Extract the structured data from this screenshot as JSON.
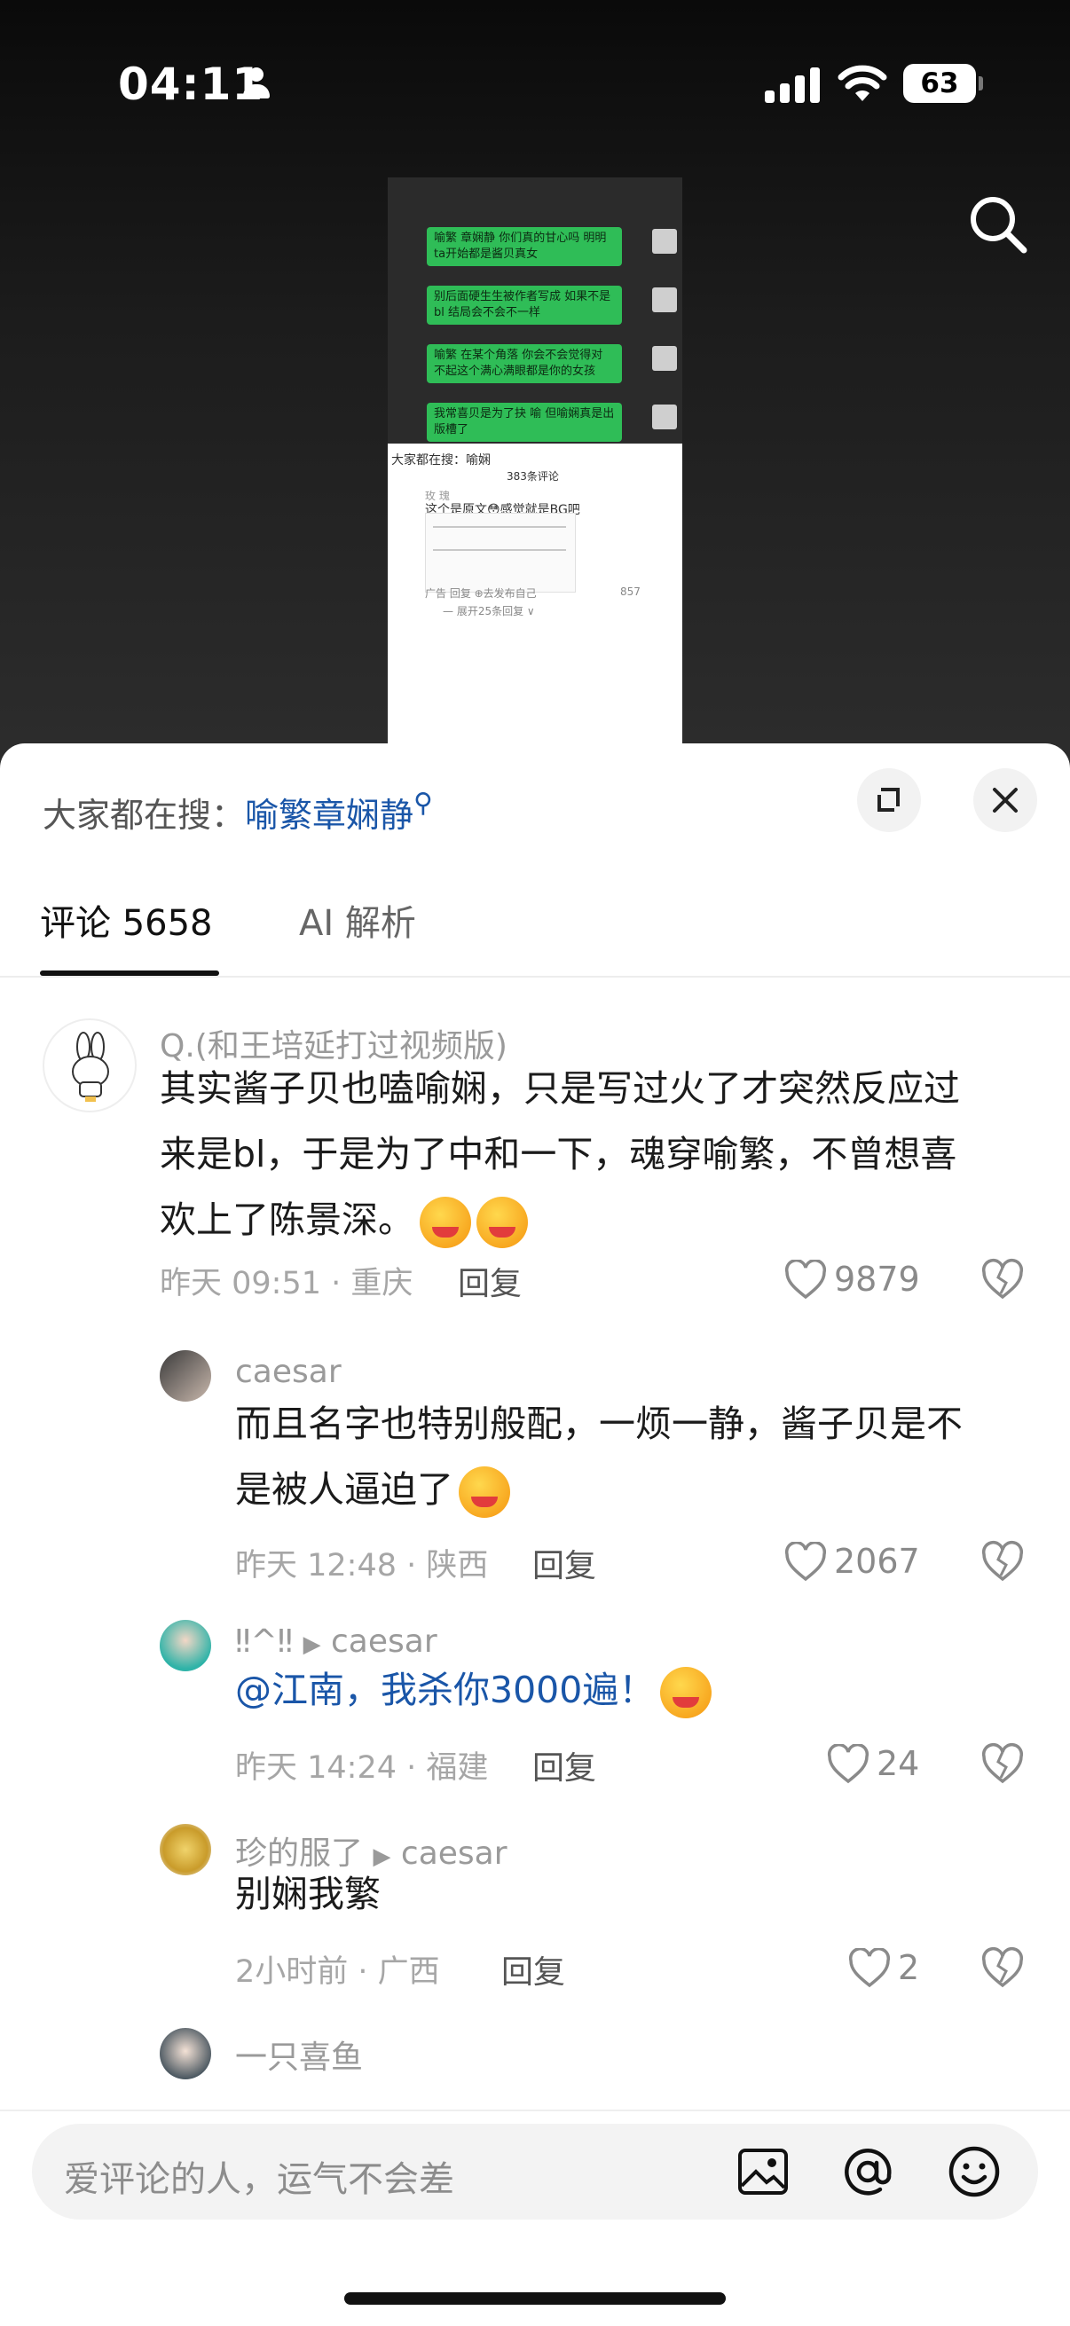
{
  "status_bar": {
    "time": "04:11",
    "battery": "63"
  },
  "thumbnail": {
    "bubbles": [
      "喻繁 章娴静 你们真的甘心吗 明明ta开始都是酱贝真女",
      "别后面硬生生被作者写成 如果不是bl 结局会不会不一样",
      "喻繁 在某个角落 你会不会觉得对 不起这个满心满眼都是你的女孩",
      "我常喜贝是为了抉 喻 但喻娴真是出版槽了"
    ],
    "search_hint": "大家都在搜：喻娴",
    "count": "383条评论",
    "user": "玫 瑰",
    "text": "这个是原文😳感觉就是BG吧",
    "meta": "广告  回复  ⊕去发布自己",
    "likes": "857",
    "expand": "— 展开25条回复 ∨"
  },
  "sheet": {
    "search_label": "大家都在搜：",
    "search_keyword": "喻繁章娴静",
    "tabs": {
      "comments": "评论 5658",
      "ai": "AI 解析"
    }
  },
  "comments": [
    {
      "name": "Q.(和王培延打过视频版)",
      "lines": [
        "其实酱子贝也嗑喻娴，只是写过火了才突然反应过",
        "来是bl，于是为了中和一下，魂穿喻繁，不曾想喜",
        "欢上了陈景深。"
      ],
      "meta": "昨天 09:51 · 重庆",
      "reply": "回复",
      "likes": "9879"
    },
    {
      "name": "caesar",
      "lines": [
        "而且名字也特别般配，一烦一静，酱子贝是不",
        "是被人逼迫了"
      ],
      "meta": "昨天 12:48 · 陕西",
      "reply": "回复",
      "likes": "2067"
    },
    {
      "name": "‼^‼",
      "reply_to": "caesar",
      "lines": [
        "@江南，我杀你3000遍！"
      ],
      "meta": "昨天 14:24 · 福建",
      "reply": "回复",
      "likes": "24"
    },
    {
      "name": "珍的服了",
      "reply_to": "caesar",
      "lines": [
        "别娴我繁"
      ],
      "meta": "2小时前 · 广西",
      "reply": "回复",
      "likes": "2"
    },
    {
      "name": "一只喜鱼"
    }
  ],
  "input": {
    "placeholder": "爱评论的人，运气不会差"
  },
  "icons": [
    "search-icon",
    "expand-icon",
    "close-icon",
    "heart-icon",
    "broken-heart-icon",
    "image-icon",
    "at-icon",
    "emoji-icon"
  ]
}
